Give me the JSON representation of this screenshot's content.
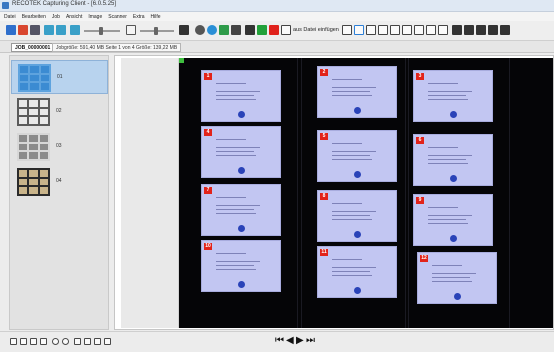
{
  "window": {
    "title": "RECOTEK Capturing Client - [6.0.5.25]"
  },
  "menu": [
    "Datei",
    "Bearbeiten",
    "Job",
    "Ansicht",
    "Image",
    "Scanner",
    "Extra",
    "Hilfe"
  ],
  "toolbar": {
    "insert_label": "aus Datei einfügen"
  },
  "tab": {
    "job_label": "JOB_00000001",
    "info": "Jobgröße: 591,40 MB  Seite 1 von 4  Größe: 139,22 MB"
  },
  "thumbnails": [
    {
      "number": "01",
      "paper_color": "#3b8bd2",
      "bg_color": "#5ea3de"
    },
    {
      "number": "02",
      "paper_color": "#e9e9e9",
      "bg_color": "#5b5b5b"
    },
    {
      "number": "03",
      "paper_color": "#8b8b8b",
      "bg_color": "#d7d7d7"
    },
    {
      "number": "04",
      "paper_color": "#c9b48a",
      "bg_color": "#2b2b2b"
    }
  ],
  "cards": [
    "1",
    "2",
    "3",
    "4",
    "5",
    "6",
    "7",
    "8",
    "9",
    "10",
    "11",
    "12"
  ],
  "colors": {
    "selection": "#b8d3ee",
    "card": "#c2c6f2",
    "tag": "#e2231a",
    "scan_bg": "#050507"
  },
  "navigation": {
    "first": "⏮",
    "prev": "◀",
    "next": "▶",
    "last": "⏭"
  }
}
